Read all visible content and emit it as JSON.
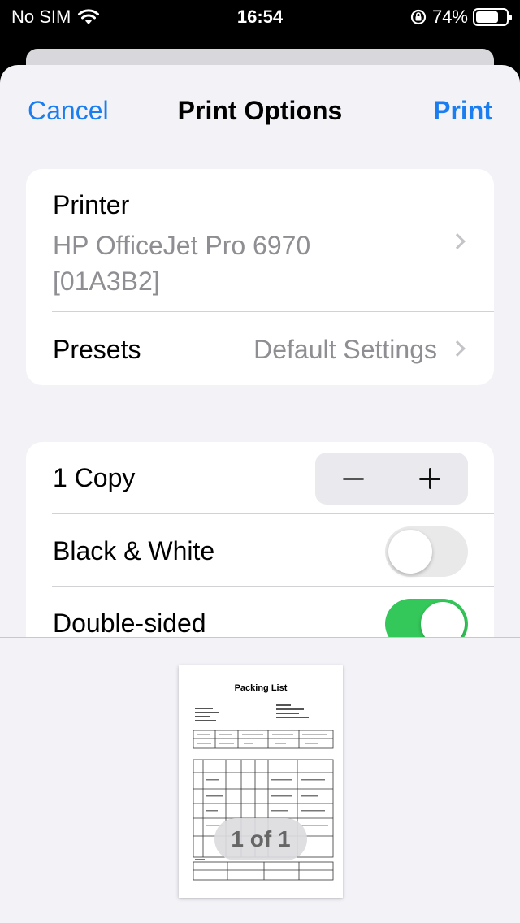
{
  "status_bar": {
    "carrier": "No SIM",
    "time": "16:54",
    "battery": "74%",
    "battery_level": 0.74
  },
  "nav": {
    "cancel": "Cancel",
    "title": "Print Options",
    "print": "Print"
  },
  "printer": {
    "label": "Printer",
    "name_line1": "HP OfficeJet Pro 6970",
    "name_line2": "[01A3B2]"
  },
  "presets": {
    "label": "Presets",
    "value": "Default Settings"
  },
  "copies": {
    "label": "1 Copy"
  },
  "black_white": {
    "label": "Black & White",
    "on": false
  },
  "double_sided": {
    "label": "Double-sided",
    "on": true
  },
  "preview": {
    "doc_title": "Packing List",
    "page_indicator": "1 of 1"
  },
  "colors": {
    "accent": "#1a7ef0",
    "switch_on": "#34c759",
    "background": "#f2f2f7"
  }
}
